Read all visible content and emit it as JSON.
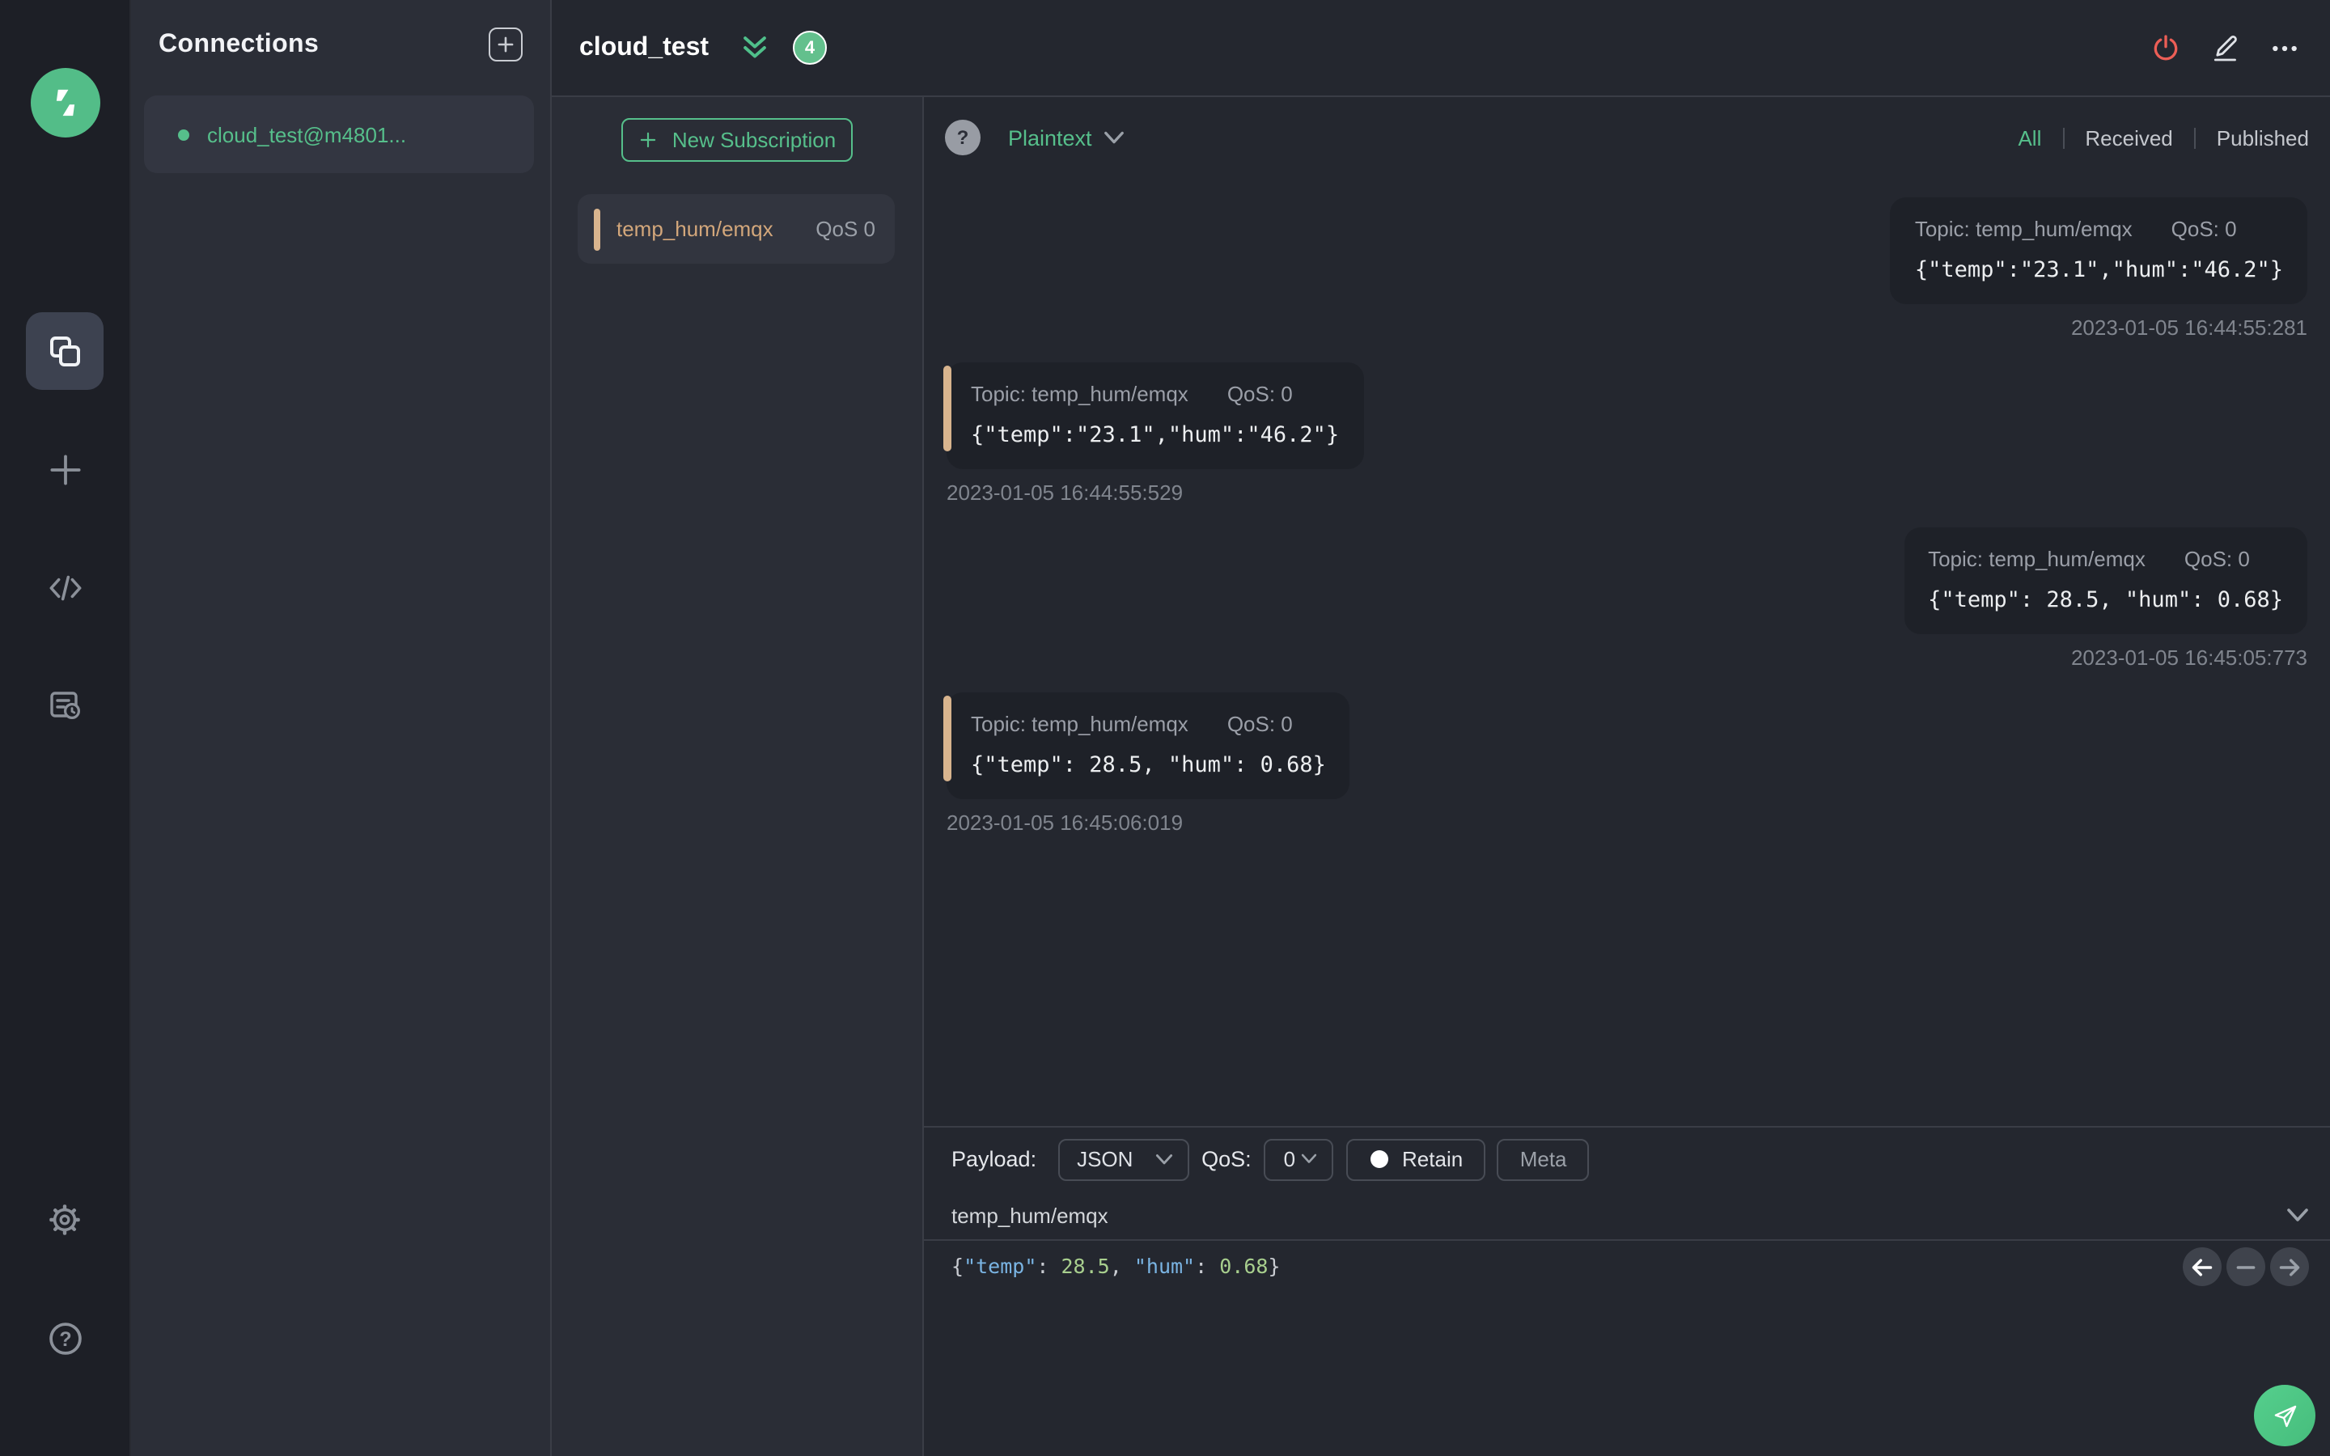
{
  "colors": {
    "accent_green": "#56bf8b",
    "accent_tan": "#d8b48e",
    "danger_red": "#ec5e56",
    "badge_green": "#63c08d",
    "syntax_key_blue": "#7ab4e3",
    "syntax_num_green": "#a8cf8e"
  },
  "rail": {
    "icons": [
      "mqttx-logo",
      "connections-icon",
      "new-window-icon",
      "script-icon",
      "log-icon",
      "settings-gear-icon",
      "help-icon"
    ]
  },
  "connections_panel": {
    "title": "Connections",
    "connection": {
      "name": "cloud_test@m4801...",
      "status": "connected"
    }
  },
  "topbar": {
    "title": "cloud_test",
    "message_count": "4",
    "icons": [
      "disconnect-power-icon",
      "edit-pencil-icon",
      "more-ellipsis-icon"
    ]
  },
  "subscriptions_panel": {
    "new_subscription_label": "New Subscription",
    "subscriptions": [
      {
        "topic": "temp_hum/emqx",
        "qos": "QoS 0"
      }
    ]
  },
  "message_toolbar": {
    "help_glyph": "?",
    "format": "Plaintext",
    "filters": [
      {
        "label": "All",
        "active": true
      },
      {
        "label": "Received",
        "active": false
      },
      {
        "label": "Published",
        "active": false
      }
    ]
  },
  "messages": {
    "topic_label": "Topic:",
    "qos_label": "QoS:",
    "items": [
      {
        "direction": "published",
        "topic": "temp_hum/emqx",
        "qos": "0",
        "payload": "{\"temp\":\"23.1\",\"hum\":\"46.2\"}",
        "time": "2023-01-05 16:44:55:281"
      },
      {
        "direction": "received",
        "topic": "temp_hum/emqx",
        "qos": "0",
        "payload": "{\"temp\":\"23.1\",\"hum\":\"46.2\"}",
        "time": "2023-01-05 16:44:55:529"
      },
      {
        "direction": "published",
        "topic": "temp_hum/emqx",
        "qos": "0",
        "payload": "{\"temp\": 28.5, \"hum\": 0.68}",
        "time": "2023-01-05 16:45:05:773"
      },
      {
        "direction": "received",
        "topic": "temp_hum/emqx",
        "qos": "0",
        "payload": "{\"temp\": 28.5, \"hum\": 0.68}",
        "time": "2023-01-05 16:45:06:019"
      }
    ]
  },
  "publish": {
    "payload_label": "Payload:",
    "payload_type": "JSON",
    "qos_label": "QoS:",
    "qos_value": "0",
    "retain_label": "Retain",
    "meta_label": "Meta",
    "topic": "temp_hum/emqx",
    "payload": "{\"temp\": 28.5, \"hum\": 0.68}"
  }
}
